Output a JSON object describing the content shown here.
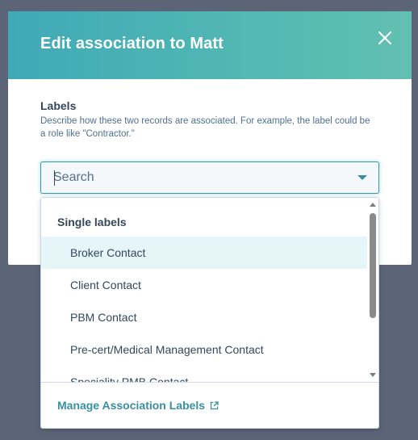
{
  "modal": {
    "title": "Edit association to Matt",
    "close_icon": "close-icon"
  },
  "field": {
    "label": "Labels",
    "help": "Describe how these two records are associated. For example, the label could be a role like \"Contractor.\""
  },
  "search": {
    "placeholder": "Search",
    "value": ""
  },
  "dropdown": {
    "group_label": "Single labels",
    "options": [
      "Broker Contact",
      "Client Contact",
      "PBM Contact",
      "Pre-cert/Medical Management Contact",
      "Speciality PMB Contact"
    ],
    "highlighted": "Broker Contact",
    "footer_link": "Manage Association Labels",
    "footer_icon": "external-link-icon"
  },
  "colors": {
    "header_gradient_start": "#40a9b6",
    "header_gradient_end": "#62c0b1",
    "backdrop": "#5b6577",
    "accent": "#3a8ea2",
    "highlight_bg": "#e5f5f8"
  }
}
